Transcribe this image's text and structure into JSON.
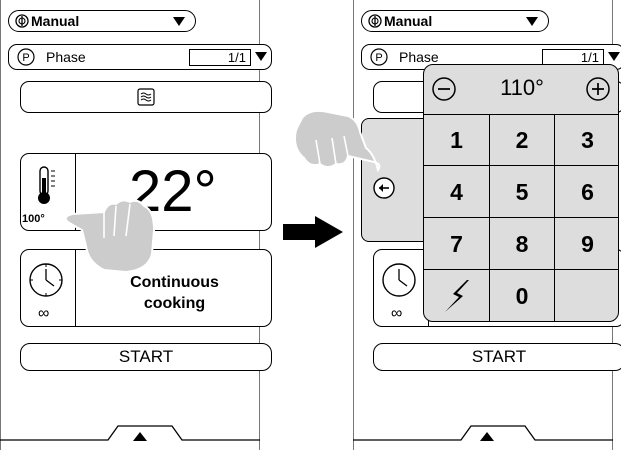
{
  "left": {
    "mode": {
      "label": "Manual"
    },
    "phase": {
      "label": "Phase",
      "value": "1/1"
    },
    "temperature": {
      "setpoint": "100°",
      "current": "22°"
    },
    "time": {
      "mode": "Continuous cooking",
      "value": "∞"
    },
    "start": {
      "label": "START"
    }
  },
  "right": {
    "mode": {
      "label": "Manual"
    },
    "phase": {
      "label": "Phase",
      "value": "1/1"
    },
    "time": {
      "value": "∞"
    },
    "start": {
      "label": "START"
    },
    "keypad": {
      "value": "110°",
      "keys": [
        "1",
        "2",
        "3",
        "4",
        "5",
        "6",
        "7",
        "8",
        "9",
        "0"
      ]
    }
  },
  "icons": [
    "mode-icon",
    "phase-icon",
    "steam-icon",
    "thermometer-icon",
    "clock-icon",
    "back-icon",
    "minus-icon",
    "plus-icon",
    "lightning-icon",
    "chevron-up-icon",
    "hand-icon",
    "arrow-icon"
  ]
}
